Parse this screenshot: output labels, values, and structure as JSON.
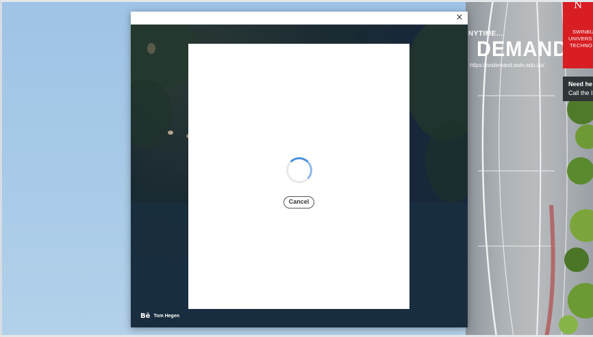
{
  "wallpaper": {
    "banner_anytime": "NYTIME...",
    "banner_demand": "DEMAND",
    "banner_url": "https://ondemand.swin.edu.au/",
    "swin_lines": [
      "SWINBU",
      "UNIVERS",
      "TECHNO"
    ],
    "help_title": "Need he",
    "help_sub": "Call the I"
  },
  "dialog": {
    "close_label": "×",
    "cancel_label": "Cancel",
    "credit_icon": "Bē",
    "credit_name": "Tom Hegen"
  },
  "colors": {
    "spinner_accent": "#4a8fe0",
    "swin_red": "#d81d23"
  }
}
